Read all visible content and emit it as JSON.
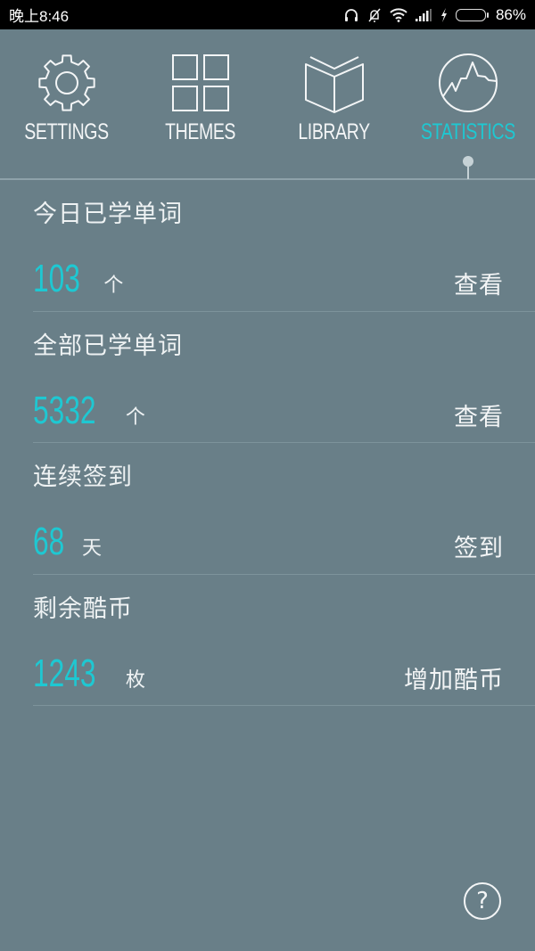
{
  "status_bar": {
    "time": "晚上8:46",
    "icons": [
      "headset-icon",
      "alarm-off-icon",
      "wifi-icon",
      "signal-icon",
      "charging-icon",
      "battery-icon"
    ],
    "battery_percent": "86%",
    "battery_level": 0.86,
    "battery_color": "#4cd118"
  },
  "nav": {
    "items": [
      {
        "label": "SETTINGS",
        "icon": "gear-icon"
      },
      {
        "label": "THEMES",
        "icon": "grid-icon"
      },
      {
        "label": "LIBRARY",
        "icon": "book-icon"
      },
      {
        "label": "STATISTICS",
        "icon": "chart-icon"
      }
    ],
    "active": "STATISTICS",
    "accent_color": "#1ec8d2"
  },
  "stats": [
    {
      "title": "今日已学单词",
      "value": "103",
      "unit": "个",
      "action": "查看"
    },
    {
      "title": "全部已学单词",
      "value": "5332",
      "unit": "个",
      "action": "查看"
    },
    {
      "title": "连续签到",
      "value": "68",
      "unit": "天",
      "action": "签到"
    },
    {
      "title": "剩余酷币",
      "value": "1243",
      "unit": "枚",
      "action": "增加酷币"
    }
  ],
  "help": {
    "label": "?",
    "icon": "help-icon"
  }
}
